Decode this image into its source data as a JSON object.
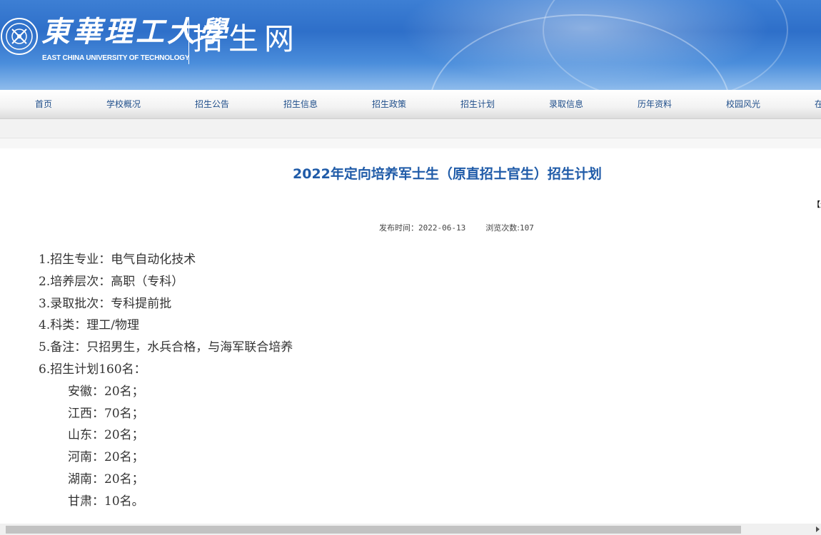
{
  "header": {
    "school_name_cn": "東華理工大學",
    "school_name_en": "EAST CHINA UNIVERSITY OF TECHNOLOGY",
    "site_name": "招生网",
    "logo_icon": "university-seal-icon"
  },
  "nav": {
    "items": [
      {
        "label": "首页"
      },
      {
        "label": "学校概况"
      },
      {
        "label": "招生公告"
      },
      {
        "label": "招生信息"
      },
      {
        "label": "招生政策"
      },
      {
        "label": "招生计划"
      },
      {
        "label": "录取信息"
      },
      {
        "label": "历年资料"
      },
      {
        "label": "校园风光"
      },
      {
        "label": "在"
      }
    ]
  },
  "article": {
    "title": "2022年定向培养军士生（原直招士官生）招生计划",
    "right_marker": "【返",
    "publish_label": "发布时间：",
    "publish_date": "2022-06-13",
    "views_label": "浏览次数:",
    "views": "107",
    "lines": [
      "1.招生专业：电气自动化技术",
      "2.培养层次：高职（专科）",
      "3.录取批次：专科提前批",
      "4.科类：理工/物理",
      "5.备注：只招男生，水兵合格，与海军联合培养",
      "6.招生计划160名："
    ],
    "quota": [
      "安徽：20名；",
      "江西：70名；",
      "山东：20名；",
      "河南：20名；",
      "湖南：20名；",
      "甘肃：10名。"
    ]
  },
  "colors": {
    "banner": "#2e6fc9",
    "nav_text": "#1f4e8a",
    "title": "#1f5ba8"
  }
}
